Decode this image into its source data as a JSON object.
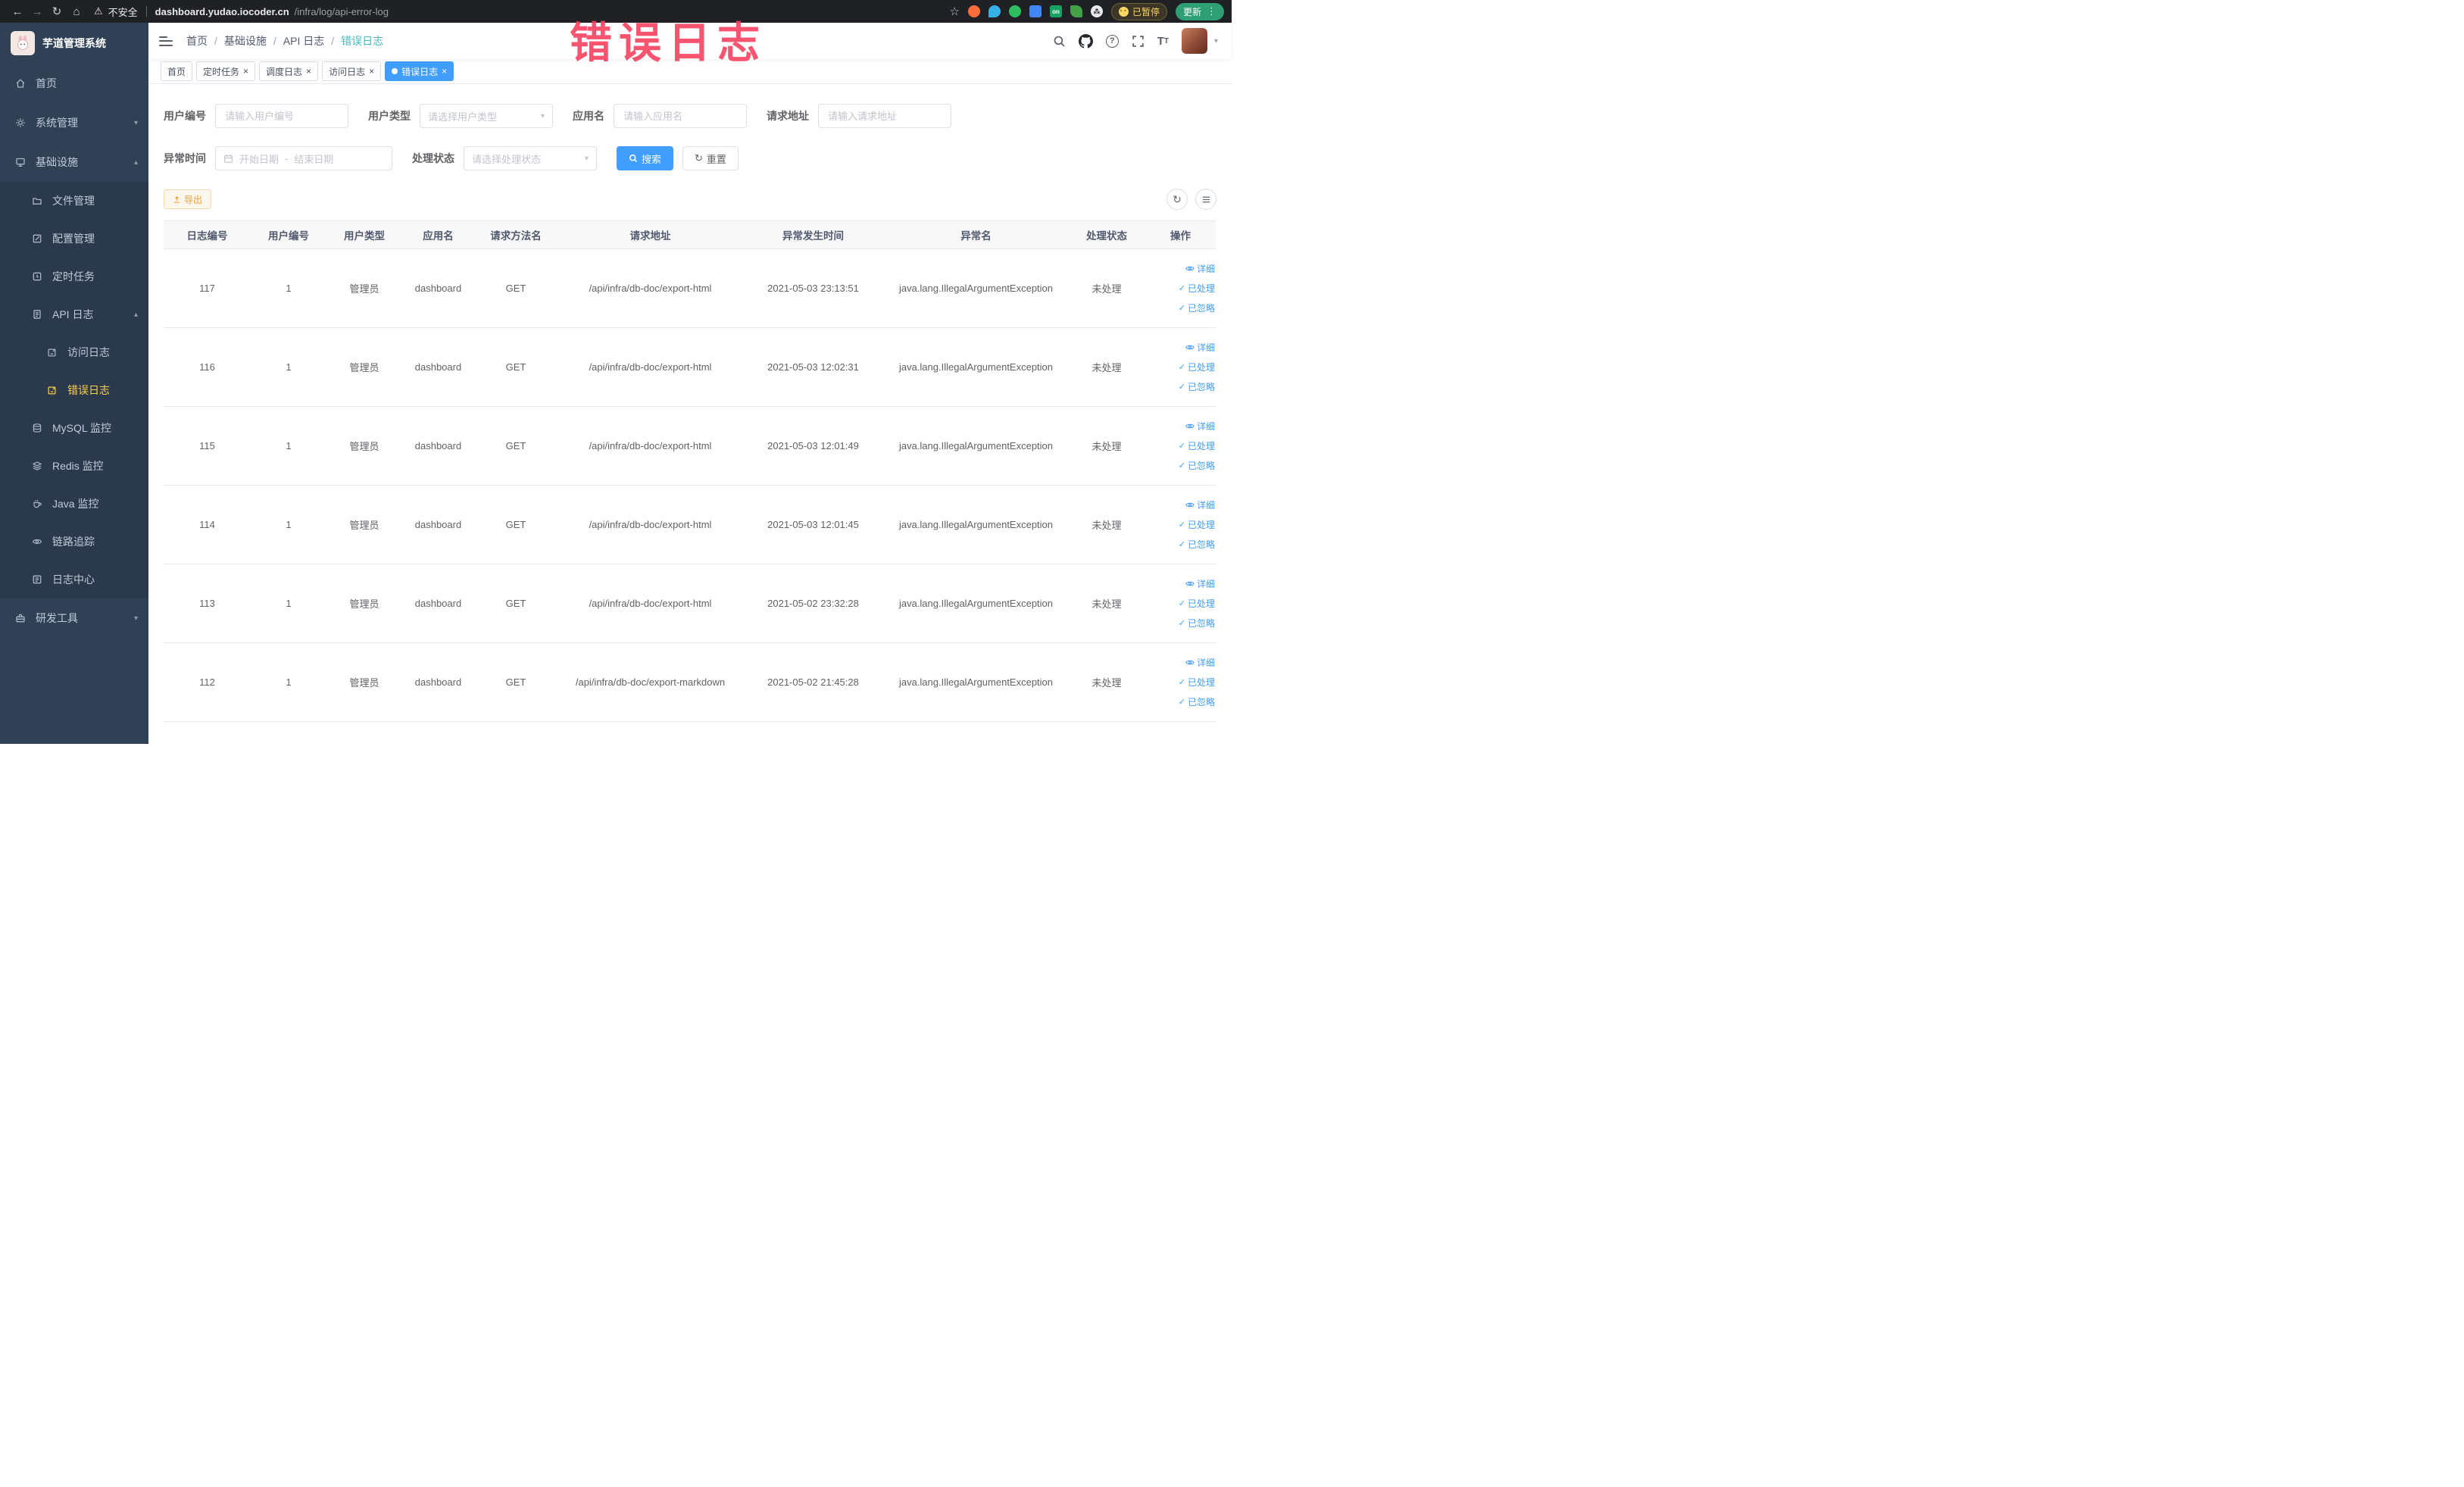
{
  "browser": {
    "not_secure": "不安全",
    "url_host": "dashboard.yudao.iocoder.cn",
    "url_path": "/infra/log/api-error-log",
    "ext_on": "on",
    "paused_label": "已暂停",
    "update_label": "更新"
  },
  "watermark": "错误日志",
  "sidebar": {
    "logo_title": "芋道管理系统",
    "items": {
      "home": "首页",
      "system": "系统管理",
      "infra": "基础设施",
      "file": "文件管理",
      "config": "配置管理",
      "job": "定时任务",
      "api_log": "API 日志",
      "access_log": "访问日志",
      "error_log": "错误日志",
      "mysql": "MySQL 监控",
      "redis": "Redis 监控",
      "java": "Java 监控",
      "trace": "链路追踪",
      "log_center": "日志中心",
      "dev": "研发工具"
    }
  },
  "header": {
    "breadcrumb": [
      "首页",
      "基础设施",
      "API 日志",
      "错误日志"
    ],
    "separator": "/"
  },
  "tabs": {
    "home": "首页",
    "job": "定时任务",
    "job_log": "调度日志",
    "access_log": "访问日志",
    "error_log": "错误日志"
  },
  "filters": {
    "user_id_label": "用户编号",
    "user_id_placeholder": "请输入用户编号",
    "user_type_label": "用户类型",
    "user_type_placeholder": "请选择用户类型",
    "app_name_label": "应用名",
    "app_name_placeholder": "请输入应用名",
    "request_url_label": "请求地址",
    "request_url_placeholder": "请输入请求地址",
    "exception_time_label": "异常时间",
    "date_start_placeholder": "开始日期",
    "date_separator": "-",
    "date_end_placeholder": "结束日期",
    "process_status_label": "处理状态",
    "process_status_placeholder": "请选择处理状态",
    "search_label": "搜索",
    "reset_label": "重置"
  },
  "toolbar": {
    "export_label": "导出"
  },
  "table": {
    "columns": [
      "日志编号",
      "用户编号",
      "用户类型",
      "应用名",
      "请求方法名",
      "请求地址",
      "异常发生时间",
      "异常名",
      "处理状态",
      "操作"
    ],
    "action_labels": [
      "详细",
      "已处理",
      "已忽略"
    ],
    "rows": [
      {
        "id": "117",
        "user_id": "1",
        "user_type": "管理员",
        "app": "dashboard",
        "method": "GET",
        "url": "/api/infra/db-doc/export-html",
        "time": "2021-05-03 23:13:51",
        "exception": "java.lang.IllegalArgumentException",
        "status": "未处理"
      },
      {
        "id": "116",
        "user_id": "1",
        "user_type": "管理员",
        "app": "dashboard",
        "method": "GET",
        "url": "/api/infra/db-doc/export-html",
        "time": "2021-05-03 12:02:31",
        "exception": "java.lang.IllegalArgumentException",
        "status": "未处理"
      },
      {
        "id": "115",
        "user_id": "1",
        "user_type": "管理员",
        "app": "dashboard",
        "method": "GET",
        "url": "/api/infra/db-doc/export-html",
        "time": "2021-05-03 12:01:49",
        "exception": "java.lang.IllegalArgumentException",
        "status": "未处理"
      },
      {
        "id": "114",
        "user_id": "1",
        "user_type": "管理员",
        "app": "dashboard",
        "method": "GET",
        "url": "/api/infra/db-doc/export-html",
        "time": "2021-05-03 12:01:45",
        "exception": "java.lang.IllegalArgumentException",
        "status": "未处理"
      },
      {
        "id": "113",
        "user_id": "1",
        "user_type": "管理员",
        "app": "dashboard",
        "method": "GET",
        "url": "/api/infra/db-doc/export-html",
        "time": "2021-05-02 23:32:28",
        "exception": "java.lang.IllegalArgumentException",
        "status": "未处理"
      },
      {
        "id": "112",
        "user_id": "1",
        "user_type": "管理员",
        "app": "dashboard",
        "method": "GET",
        "url": "/api/infra/db-doc/export-markdown",
        "time": "2021-05-02 21:45:28",
        "exception": "java.lang.IllegalArgumentException",
        "status": "未处理"
      }
    ]
  },
  "colors": {
    "accent": "#409eff",
    "sidebar_bg": "#304156",
    "active_menu_text": "#ffd04b",
    "breadcrumb_active": "#4ab7bd",
    "export_warning": "#e6a23c",
    "watermark_red": "#f7405f"
  }
}
